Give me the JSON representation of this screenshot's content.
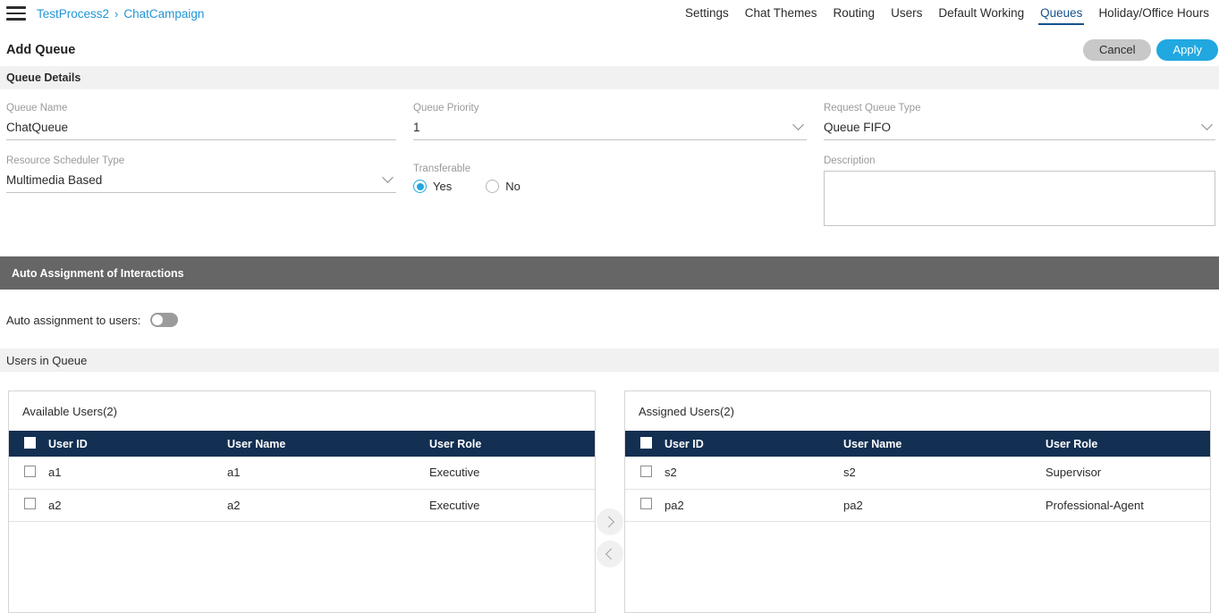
{
  "topbar": {
    "menu_icon": "hamburger-menu-icon",
    "breadcrumb": [
      {
        "label": "TestProcess2"
      },
      {
        "label": "ChatCampaign"
      }
    ],
    "breadcrumb_separator": "›",
    "tabs": [
      {
        "label": "Settings",
        "active": false
      },
      {
        "label": "Chat Themes",
        "active": false
      },
      {
        "label": "Routing",
        "active": false
      },
      {
        "label": "Users",
        "active": false
      },
      {
        "label": "Default Working",
        "active": false
      },
      {
        "label": "Queues",
        "active": true
      },
      {
        "label": "Holiday/Office Hours",
        "active": false
      }
    ]
  },
  "page": {
    "title": "Add Queue",
    "cancel_label": "Cancel",
    "apply_label": "Apply"
  },
  "queue_details": {
    "section_title": "Queue Details",
    "queue_name": {
      "label": "Queue Name",
      "value": "ChatQueue"
    },
    "queue_priority": {
      "label": "Queue Priority",
      "value": "1",
      "icon": "chevron-down-icon"
    },
    "request_queue_type": {
      "label": "Request Queue Type",
      "value": "Queue FIFO",
      "icon": "chevron-down-icon"
    },
    "resource_scheduler_type": {
      "label": "Resource Scheduler Type",
      "value": "Multimedia Based",
      "icon": "chevron-down-icon"
    },
    "transferable": {
      "label": "Transferable",
      "options": [
        {
          "label": "Yes",
          "selected": true
        },
        {
          "label": "No",
          "selected": false
        }
      ]
    },
    "description": {
      "label": "Description",
      "value": "",
      "placeholder": ""
    }
  },
  "auto_assignment": {
    "section_title": "Auto Assignment of Interactions",
    "toggle_label": "Auto assignment to users:",
    "toggle_state": "off"
  },
  "users_in_queue": {
    "section_title": "Users in Queue",
    "columns": [
      "User ID",
      "User Name",
      "User Role"
    ],
    "available": {
      "caption": "Available Users(2)",
      "rows": [
        {
          "user_id": "a1",
          "user_name": "a1",
          "user_role": "Executive"
        },
        {
          "user_id": "a2",
          "user_name": "a2",
          "user_role": "Executive"
        }
      ]
    },
    "assigned": {
      "caption": "Assigned Users(2)",
      "rows": [
        {
          "user_id": "s2",
          "user_name": "s2",
          "user_role": "Supervisor"
        },
        {
          "user_id": "pa2",
          "user_name": "pa2",
          "user_role": "Professional-Agent"
        }
      ]
    },
    "transfer": {
      "assign_icon": "chevron-right-icon",
      "unassign_icon": "chevron-left-icon"
    }
  },
  "colors": {
    "link": "#2196d6",
    "accent_blue": "#21a8e0",
    "tab_active": "#15528c",
    "table_header": "#132f52",
    "section_dark": "#666666",
    "section_light": "#f1f1f1",
    "cancel_gray": "#c8c8c8"
  }
}
